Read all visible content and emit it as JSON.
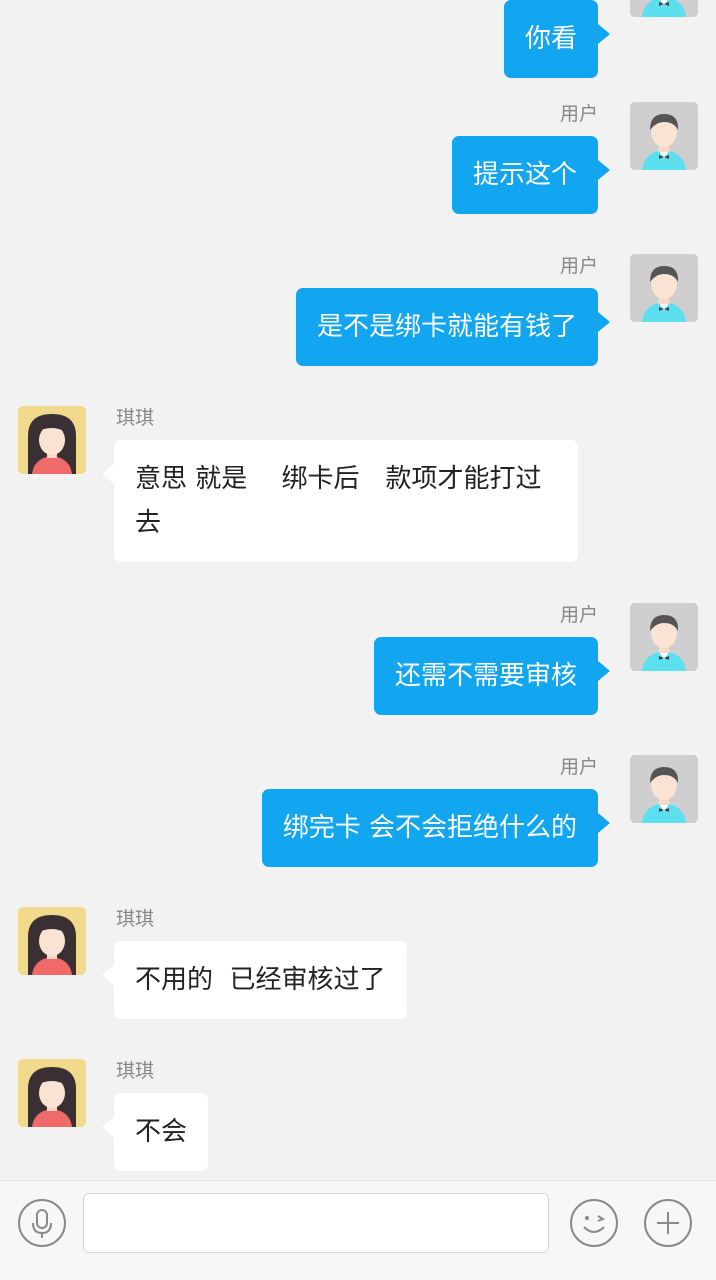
{
  "contacts": {
    "user_name": "用户",
    "agent_name": "琪琪"
  },
  "messages": [
    {
      "text": "你看"
    },
    {
      "sender": "用户",
      "text": "提示这个"
    },
    {
      "sender": "用户",
      "text": "是不是绑卡就能有钱了"
    },
    {
      "sender": "琪琪",
      "text": "意思 就是　 绑卡后　款项才能打过去"
    },
    {
      "sender": "用户",
      "text": "还需不需要审核"
    },
    {
      "sender": "用户",
      "text": "绑完卡 会不会拒绝什么的"
    },
    {
      "sender": "琪琪",
      "text": "不用的  已经审核过了"
    },
    {
      "sender": "琪琪",
      "text": "不会"
    }
  ],
  "input_bar": {
    "voice_icon": "microphone-icon",
    "emoji_icon": "smiley-icon",
    "more_icon": "plus-icon",
    "message_value": ""
  },
  "colors": {
    "background": "#f2f2f2",
    "outgoing_bubble": "#12a6f0",
    "incoming_bubble": "#ffffff",
    "user_shirt": "#5ce0f0"
  }
}
